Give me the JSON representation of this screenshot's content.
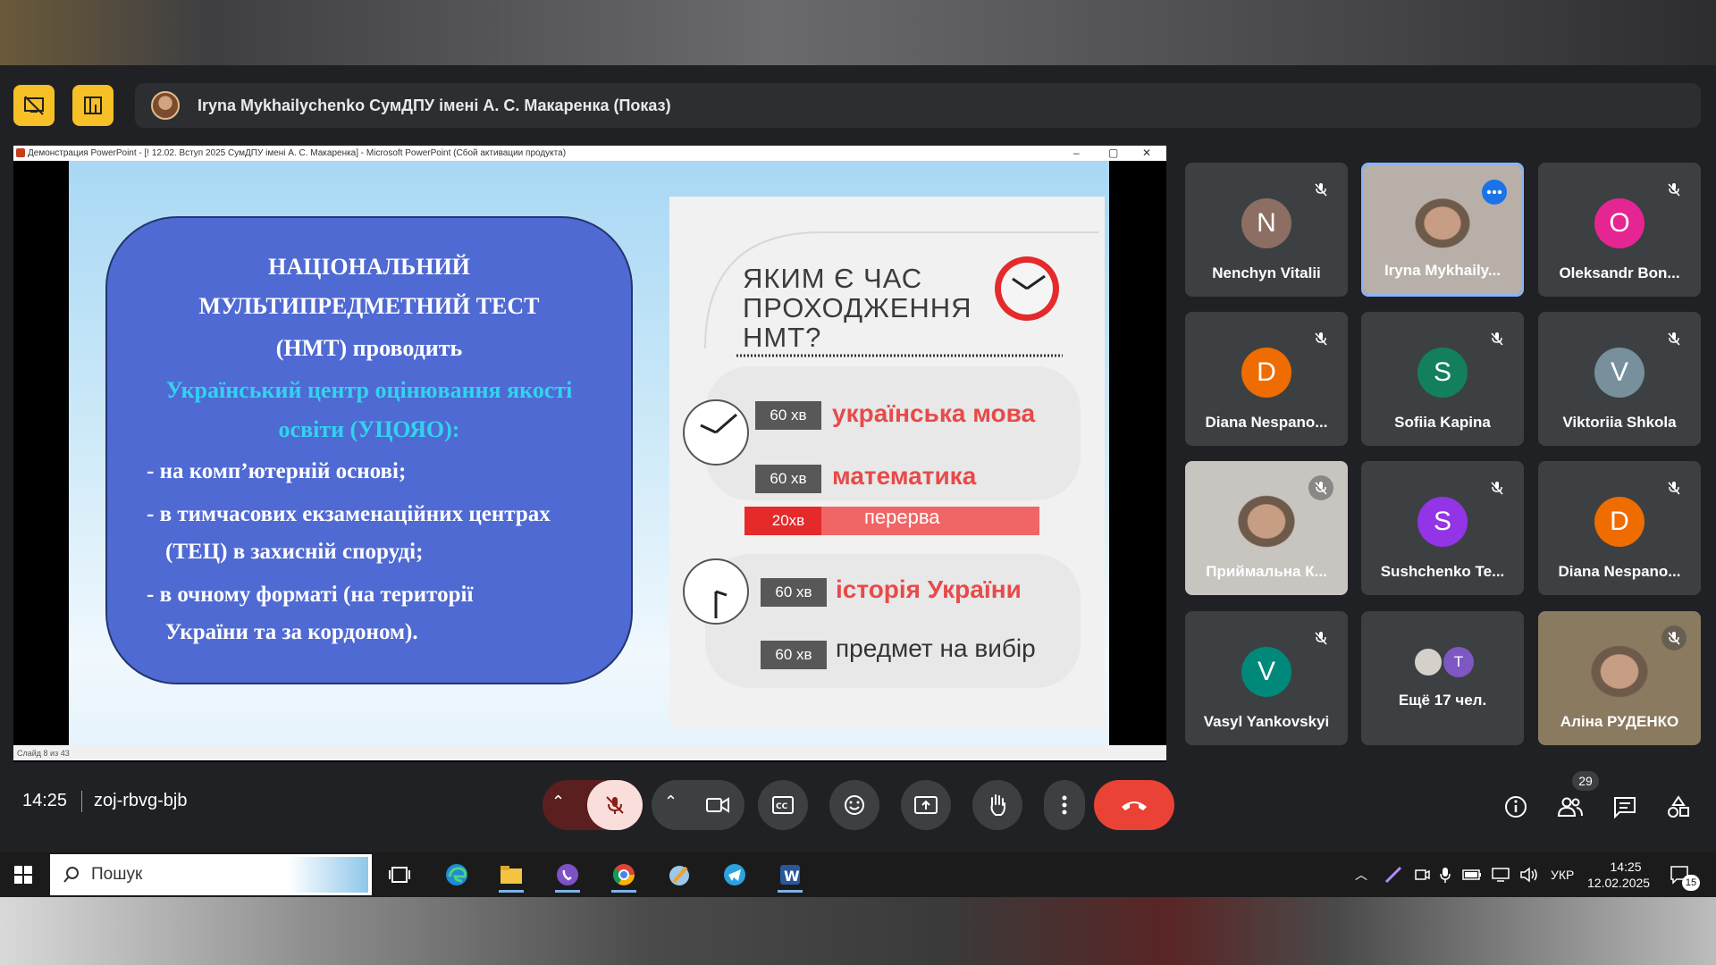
{
  "meeting": {
    "presenter_label": "Iryna Mykhailychenko СумДПУ імені А. С. Макаренка (Показ)",
    "time": "14:25",
    "meeting_code": "zoj-rbvg-bjb",
    "participants_count": "29"
  },
  "powerpoint": {
    "title_bar": "Демонстрация PowerPoint - [! 12.02. Вступ 2025 СумДПУ імені А. С. Макаренка] - Microsoft PowerPoint (Сбой активации продукта)",
    "status_left": "Слайд 8 из 43"
  },
  "slide": {
    "blue_box": {
      "line1": "НАЦІОНАЛЬНИЙ",
      "line2": "МУЛЬТИПРЕДМЕТНИЙ ТЕСТ",
      "line3": "(НМТ) проводить",
      "line4": "Український центр оцінювання якості",
      "line5": "освіти (УЦОЯО):",
      "item1": "-  на комп’ютерній основі;",
      "item2a": "-  в тимчасових екзаменаційних центрах",
      "item2b": "(ТЕЦ) в захисній споруді;",
      "item3a": "-   в очному форматі (на території",
      "item3b": "України та за кордоном)."
    },
    "card": {
      "question_l1": "ЯКИМ Є ЧАС",
      "question_l2": "ПРОХОДЖЕННЯ",
      "question_l3": "НМТ?",
      "rows": [
        {
          "time": "60 хв",
          "subject": "українська мова"
        },
        {
          "time": "60 хв",
          "subject": "математика"
        },
        {
          "time": "20хв",
          "subject": "перерва"
        },
        {
          "time": "60 хв",
          "subject": "історія України"
        },
        {
          "time": "60 хв",
          "subject": "предмет на вибір"
        }
      ]
    }
  },
  "participants": [
    {
      "initial": "N",
      "name": "Nenchyn Vitalii",
      "color": "#8d6e63"
    },
    {
      "initial": "",
      "name": "Iryna Mykhaily...",
      "color": "#b8b0a8"
    },
    {
      "initial": "O",
      "name": "Oleksandr Bon...",
      "color": "#e52592"
    },
    {
      "initial": "D",
      "name": "Diana Nespano...",
      "color": "#ef6c00"
    },
    {
      "initial": "S",
      "name": "Sofiia Kapina",
      "color": "#12805c"
    },
    {
      "initial": "V",
      "name": "Viktoriia Shkola",
      "color": "#78909c"
    },
    {
      "initial": "",
      "name": "Приймальна К...",
      "color": "#c8c4c0"
    },
    {
      "initial": "S",
      "name": "Sushchenko Te...",
      "color": "#9334e6"
    },
    {
      "initial": "D",
      "name": "Diana Nespano...",
      "color": "#ef6c00"
    },
    {
      "initial": "V",
      "name": "Vasyl Yankovskyi",
      "color": "#00897b"
    },
    {
      "initial": "T",
      "name": "Ещё 17 чел.",
      "color": "#7e57c2"
    },
    {
      "initial": "",
      "name": "Аліна РУДЕНКО",
      "color": "#8a7a60"
    }
  ],
  "taskbar": {
    "search_placeholder": "Пошук",
    "language": "УКР",
    "clock_time": "14:25",
    "clock_date": "12.02.2025",
    "notifications": "15"
  }
}
